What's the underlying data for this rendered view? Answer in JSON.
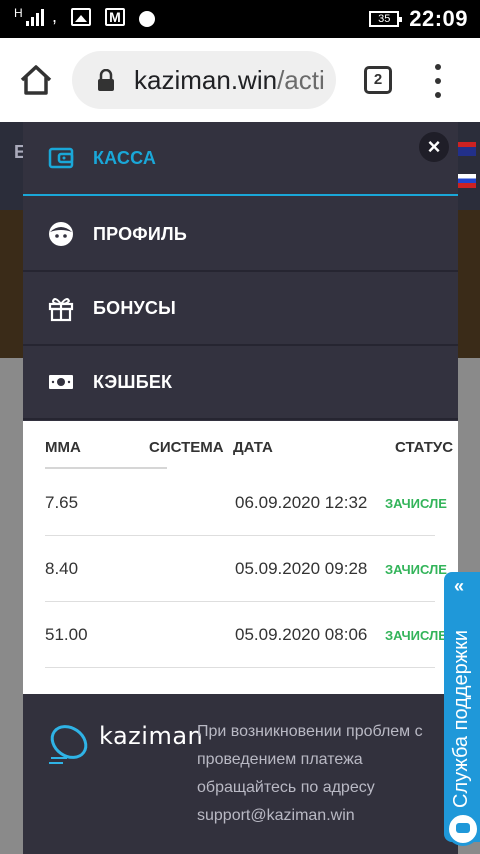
{
  "status_bar": {
    "net_letter": "H",
    "battery": "35",
    "time": "22:09",
    "icons": [
      "signal-icon",
      "image-icon",
      "gmail-icon",
      "bomb-icon",
      "battery-icon"
    ]
  },
  "browser": {
    "url_host": "kaziman.win",
    "url_path": "/acti",
    "tab_count": "2"
  },
  "menu": {
    "items": [
      {
        "label": "КАССА",
        "icon": "wallet-icon",
        "active": true
      },
      {
        "label": "ПРОФИЛЬ",
        "icon": "face-icon",
        "active": false
      },
      {
        "label": "БОНУСЫ",
        "icon": "gift-icon",
        "active": false
      },
      {
        "label": "КЭШБЕК",
        "icon": "cash-icon",
        "active": false
      }
    ],
    "close_label": "×"
  },
  "history": {
    "headers": [
      "ММА",
      "СИСТЕМА",
      "ДАТА",
      "СТАТУС"
    ],
    "rows": [
      {
        "amount": "7.65",
        "system": "",
        "date": "06.09.2020 12:32",
        "status": "ЗАЧИСЛЕ"
      },
      {
        "amount": "8.40",
        "system": "",
        "date": "05.09.2020 09:28",
        "status": "ЗАЧИСЛЕ"
      },
      {
        "amount": "51.00",
        "system": "",
        "date": "05.09.2020 08:06",
        "status": "ЗАЧИСЛЕ"
      }
    ]
  },
  "footer": {
    "logo_text": "kaziman",
    "line1": "При возникновении проблем с",
    "line2": "проведением платежа",
    "line3": "обращайтесь по адресу",
    "email": "support@kaziman.win"
  },
  "support": {
    "label": "Служба поддержки",
    "arrows": "«"
  },
  "colors": {
    "accent": "#1aa7d8",
    "menu_bg": "#33323f",
    "status_ok": "#33b45a",
    "support": "#1f98d9"
  }
}
